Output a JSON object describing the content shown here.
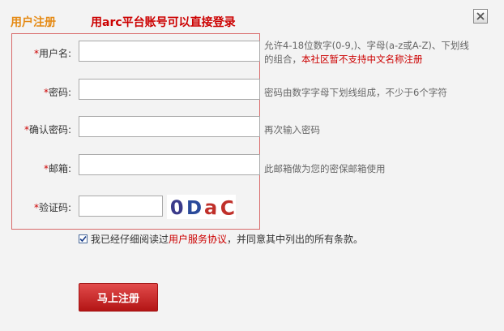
{
  "dialog": {
    "title": "用户注册",
    "notice": "用arc平台账号可以直接登录"
  },
  "form": {
    "username": {
      "label": "用户名:",
      "value": "",
      "hint_plain": "允许4-18位数字(0-9,)、字母(a-z或A-Z)、下划线的组合，",
      "hint_red": "本社区暂不支持中文名称注册"
    },
    "password": {
      "label": "密码:",
      "value": "",
      "hint": "密码由数字字母下划线组成，不少于6个字符"
    },
    "confirm": {
      "label": "确认密码:",
      "value": "",
      "hint": "再次输入密码"
    },
    "email": {
      "label": "邮箱:",
      "value": "",
      "hint": "此邮箱做为您的密保邮箱使用"
    },
    "captcha": {
      "label": "验证码:",
      "value": "",
      "image_text": "0DaC"
    }
  },
  "agreement": {
    "checked": true,
    "text_before": "我已经仔细阅读过",
    "link": "用户服务协议",
    "text_after": "，并同意其中列出的所有条款。"
  },
  "submit_label": "马上注册",
  "colors": {
    "accent_red": "#cc0000",
    "title_orange": "#e58a14",
    "button_red": "#c62828"
  },
  "icons": {
    "close": "close-icon",
    "checkbox": "checkmark-icon"
  }
}
